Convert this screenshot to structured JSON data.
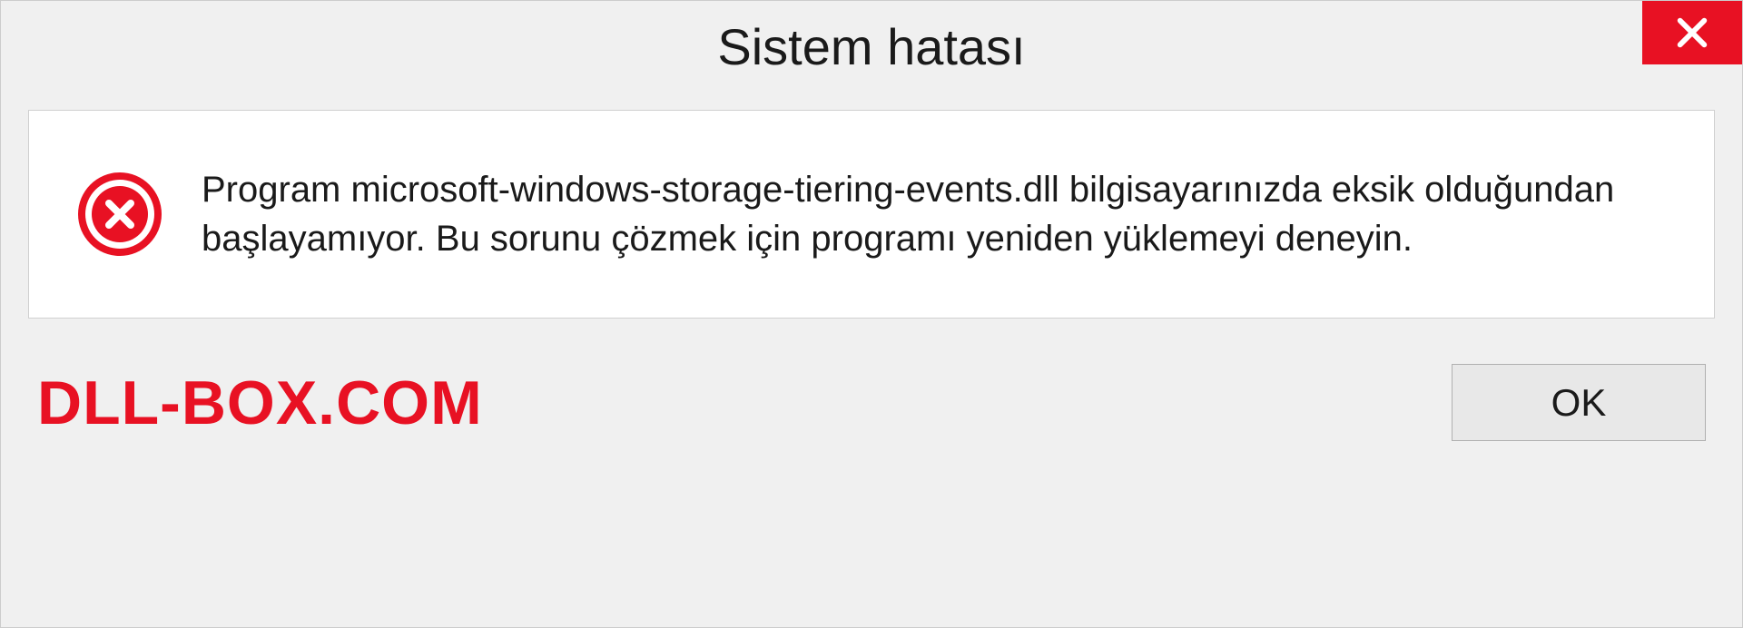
{
  "titlebar": {
    "title": "Sistem hatası"
  },
  "message": {
    "text": "Program microsoft-windows-storage-tiering-events.dll bilgisayarınızda eksik olduğundan başlayamıyor. Bu sorunu çözmek için programı yeniden yüklemeyi deneyin."
  },
  "footer": {
    "watermark": "DLL-BOX.COM",
    "ok_label": "OK"
  },
  "colors": {
    "close_bg": "#e81123",
    "watermark": "#e81123"
  }
}
